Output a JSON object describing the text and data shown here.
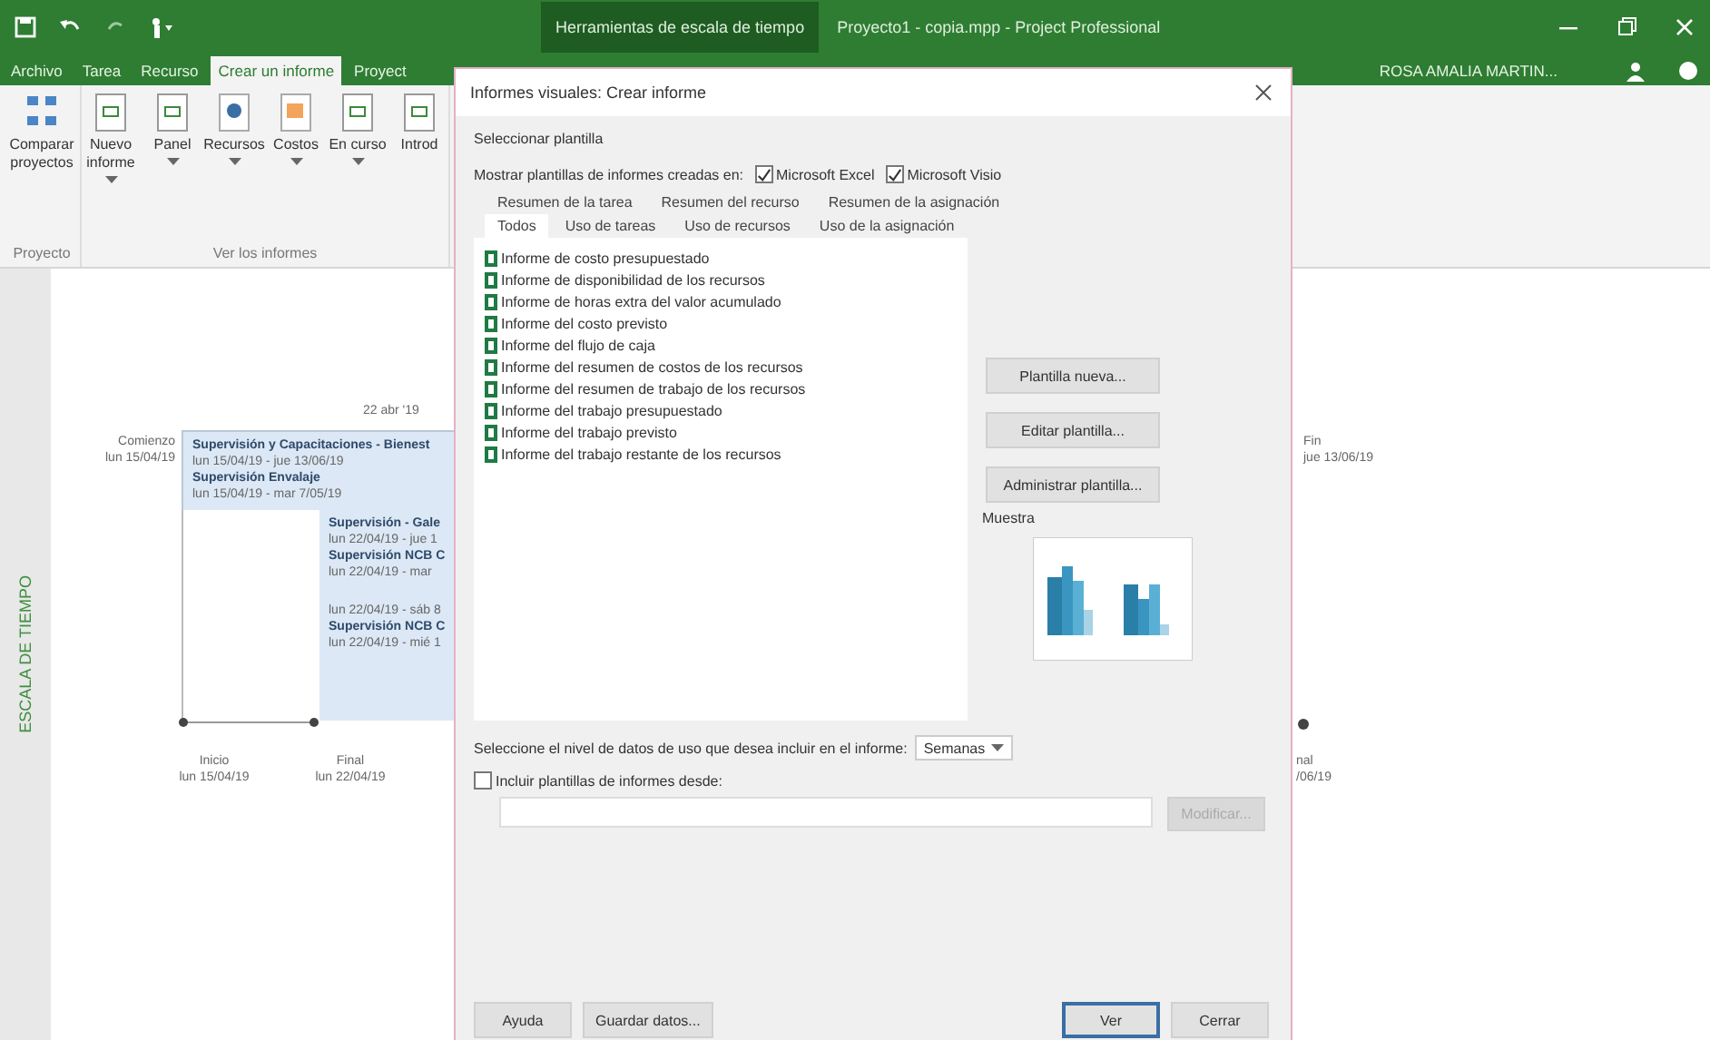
{
  "title_bar": {
    "context_tab": "Herramientas de escala de tiempo",
    "title": "Proyecto1 - copia.mpp - Project Professional",
    "user": "ROSA AMALIA MARTIN..."
  },
  "ribbon_tabs": [
    {
      "label": "Archivo",
      "selected": false
    },
    {
      "label": "Tarea",
      "selected": false
    },
    {
      "label": "Recurso",
      "selected": false
    },
    {
      "label": "Crear un informe",
      "selected": true
    },
    {
      "label": "Proyect",
      "selected": false
    }
  ],
  "ribbon_groups": [
    {
      "label": "Proyecto",
      "buttons": [
        {
          "label": "Comparar proyectos",
          "has_menu": false
        }
      ]
    },
    {
      "label": "Ver los informes",
      "buttons": [
        {
          "label": "Nuevo informe",
          "has_menu": true
        },
        {
          "label": "Panel",
          "has_menu": true
        },
        {
          "label": "Recursos",
          "has_menu": true
        },
        {
          "label": "Costos",
          "has_menu": true
        },
        {
          "label": "En curso",
          "has_menu": true
        },
        {
          "label": "Introd",
          "has_menu": false
        }
      ]
    }
  ],
  "timeline": {
    "side_label": "ESCALA DE TIEMPO",
    "date_tick": "22 abr '19",
    "start": {
      "label": "Comienzo",
      "date": "lun 15/04/19"
    },
    "upper_tasks": [
      {
        "name": "Supervisión y Capacitaciones - Bienest",
        "dates": "lun 15/04/19 - jue 13/06/19"
      },
      {
        "name": "Supervisión Envalaje",
        "dates": "lun 15/04/19 - mar 7/05/19"
      }
    ],
    "lower_tasks": [
      {
        "name": "Supervisión - Gale",
        "dates": "lun 22/04/19 - jue 1"
      },
      {
        "name": "Supervisión NCB C",
        "dates": "lun 22/04/19 - mar"
      },
      {
        "dates": "lun 22/04/19 - sáb 8"
      },
      {
        "name": "Supervisión NCB C",
        "dates": "lun 22/04/19 - mié 1"
      }
    ],
    "milestones": [
      {
        "label": "Inicio",
        "date": "lun 15/04/19"
      },
      {
        "label": "Final",
        "date": "lun 22/04/19"
      }
    ],
    "finish": {
      "label": "Fin",
      "date": "jue 13/06/19"
    },
    "right_milestone": {
      "label": "nal",
      "date": "/06/19"
    }
  },
  "dialog": {
    "title": "Informes visuales: Crear informe",
    "section": "Seleccionar plantilla",
    "show_label": "Mostrar plantillas de informes creadas en:",
    "apps": [
      {
        "label": "Microsoft Excel",
        "checked": true
      },
      {
        "label": "Microsoft Visio",
        "checked": true
      }
    ],
    "tabs_back": [
      {
        "label": "Resumen de la tarea",
        "selected": false
      },
      {
        "label": "Resumen del recurso",
        "selected": false
      },
      {
        "label": "Resumen de la asignación",
        "selected": false
      }
    ],
    "tabs_front": [
      {
        "label": "Todos",
        "selected": true
      },
      {
        "label": "Uso de tareas",
        "selected": false
      },
      {
        "label": "Uso de recursos",
        "selected": false
      },
      {
        "label": "Uso de la asignación",
        "selected": false
      }
    ],
    "templates": [
      {
        "label": "Informe de costo presupuestado",
        "selected": false
      },
      {
        "label": "Informe de disponibilidad de los recursos",
        "selected": false
      },
      {
        "label": "Informe de horas extra del valor acumulado",
        "selected": false
      },
      {
        "label": "Informe del costo previsto",
        "selected": false
      },
      {
        "label": "Informe del flujo de caja",
        "selected": false
      },
      {
        "label": "Informe del resumen de costos de los recursos",
        "selected": false
      },
      {
        "label": "Informe del resumen de trabajo de los recursos",
        "selected": false
      },
      {
        "label": "Informe del trabajo presupuestado",
        "selected": false
      },
      {
        "label": "Informe del trabajo previsto",
        "selected": false
      },
      {
        "label": "Informe del trabajo restante de los recursos",
        "selected": false
      }
    ],
    "side_buttons": [
      "Plantilla nueva...",
      "Editar plantilla...",
      "Administrar plantilla..."
    ],
    "preview_label": "Muestra",
    "level_label": "Seleccione el nivel de datos de uso que desea incluir en el informe:",
    "level_value": "Semanas",
    "include": {
      "label": "Incluir plantillas de informes desde:",
      "checked": false
    },
    "modify": {
      "label": "Modificar...",
      "disabled": true
    },
    "footer_left": [
      "Ayuda",
      "Guardar datos..."
    ],
    "footer_right": [
      {
        "label": "Ver",
        "default": true
      },
      {
        "label": "Cerrar",
        "default": false
      }
    ]
  }
}
